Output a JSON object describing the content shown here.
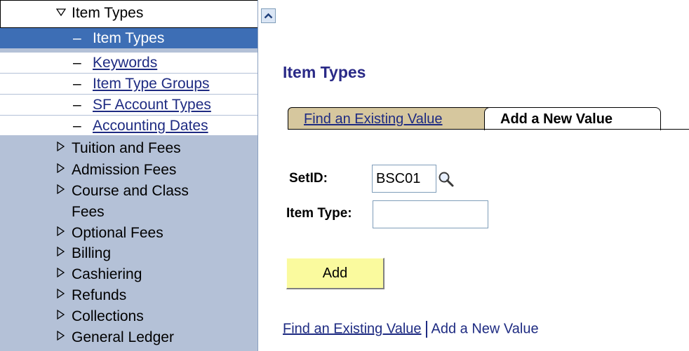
{
  "menu": {
    "header": "Item Types",
    "selected": "Item Types",
    "children": [
      "Keywords",
      "Item Type Groups",
      "SF Account Types",
      "Accounting Dates"
    ],
    "folders": [
      "Tuition and Fees",
      "Admission Fees",
      "Course and Class",
      "Fees",
      "Optional Fees",
      "Billing",
      "Cashiering",
      "Refunds",
      "Collections",
      "General Ledger"
    ]
  },
  "page": {
    "title": "Item Types",
    "tabs": {
      "find": "Find an Existing Value",
      "add": "Add a New Value"
    },
    "form": {
      "setid_label": "SetID:",
      "setid_value": "BSC01",
      "item_type_label": "Item Type:",
      "item_type_value": ""
    },
    "add_button": "Add",
    "links": {
      "find": "Find an Existing Value",
      "add": "Add a New Value"
    }
  },
  "colors": {
    "menu_bg": "#b4c1d7",
    "selected_bg": "#3d6eb5",
    "title": "#2a2a87",
    "link": "#1e2b82",
    "tab_inactive": "#d6c79e",
    "button": "#fafa9e"
  },
  "icons": {
    "expanded": "triangle-down-icon",
    "collapsed": "triangle-right-icon",
    "scroll": "chevron-up-icon",
    "lookup": "magnifier-icon"
  }
}
